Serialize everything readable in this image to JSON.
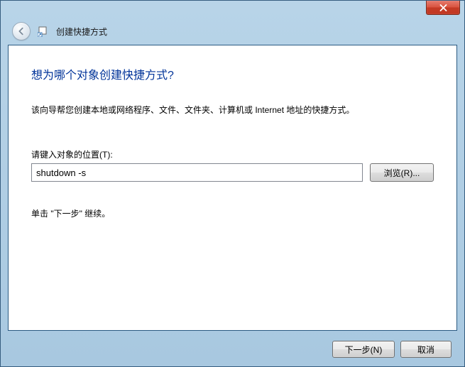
{
  "window": {
    "title": "创建快捷方式"
  },
  "content": {
    "heading": "想为哪个对象创建快捷方式?",
    "description": "该向导帮您创建本地或网络程序、文件、文件夹、计算机或 Internet 地址的快捷方式。",
    "field_label": "请键入对象的位置(T):",
    "location_value": "shutdown -s",
    "browse_label": "浏览(R)...",
    "continue_hint": "单击 \"下一步\" 继续。"
  },
  "footer": {
    "next_label": "下一步(N)",
    "cancel_label": "取消"
  }
}
